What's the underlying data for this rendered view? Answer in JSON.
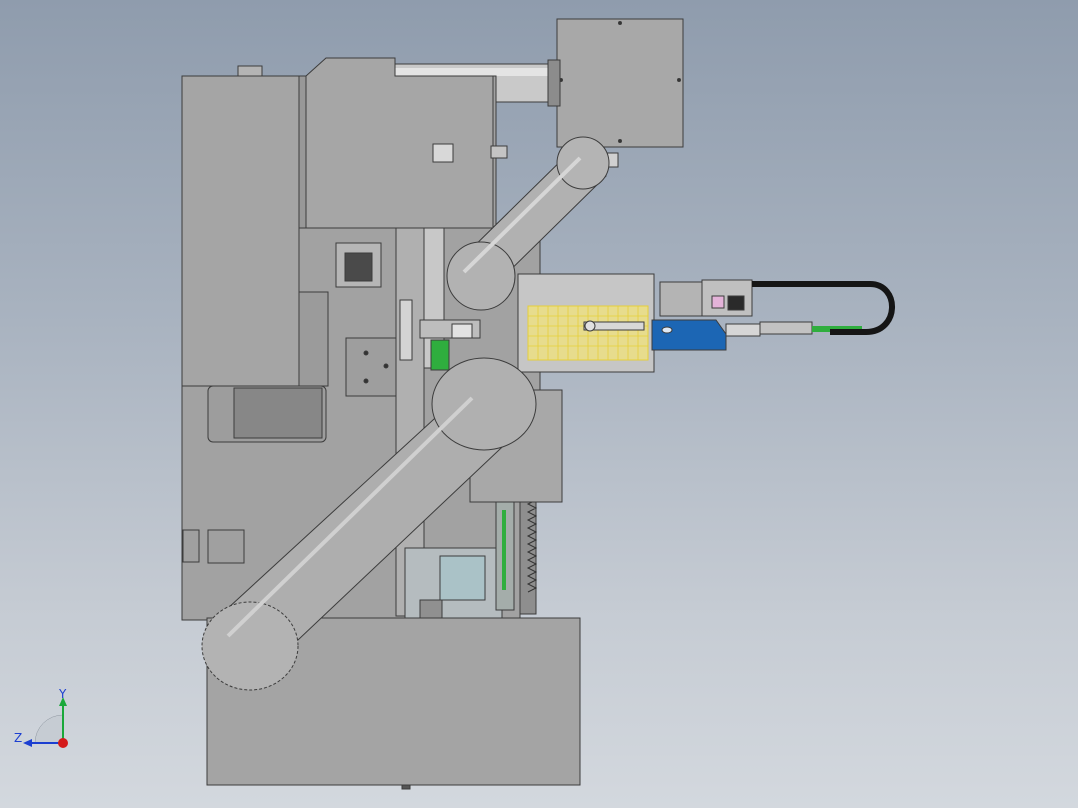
{
  "viewport": {
    "colors": {
      "background_top": "#8f9cad",
      "background_bottom": "#d3d8de",
      "body_gray": "#a4a4a4",
      "edge": "#3c3c3c",
      "accent_blue": "#1c66b4",
      "accent_yellow": "#e6cf3a",
      "accent_green": "#2fae3e",
      "hose_black": "#151515"
    }
  },
  "triad": {
    "y_label": "Y",
    "z_label": "Z",
    "y_color": "#1aa83a",
    "z_color": "#1c3fd1",
    "x_color": "#d41a1a"
  }
}
